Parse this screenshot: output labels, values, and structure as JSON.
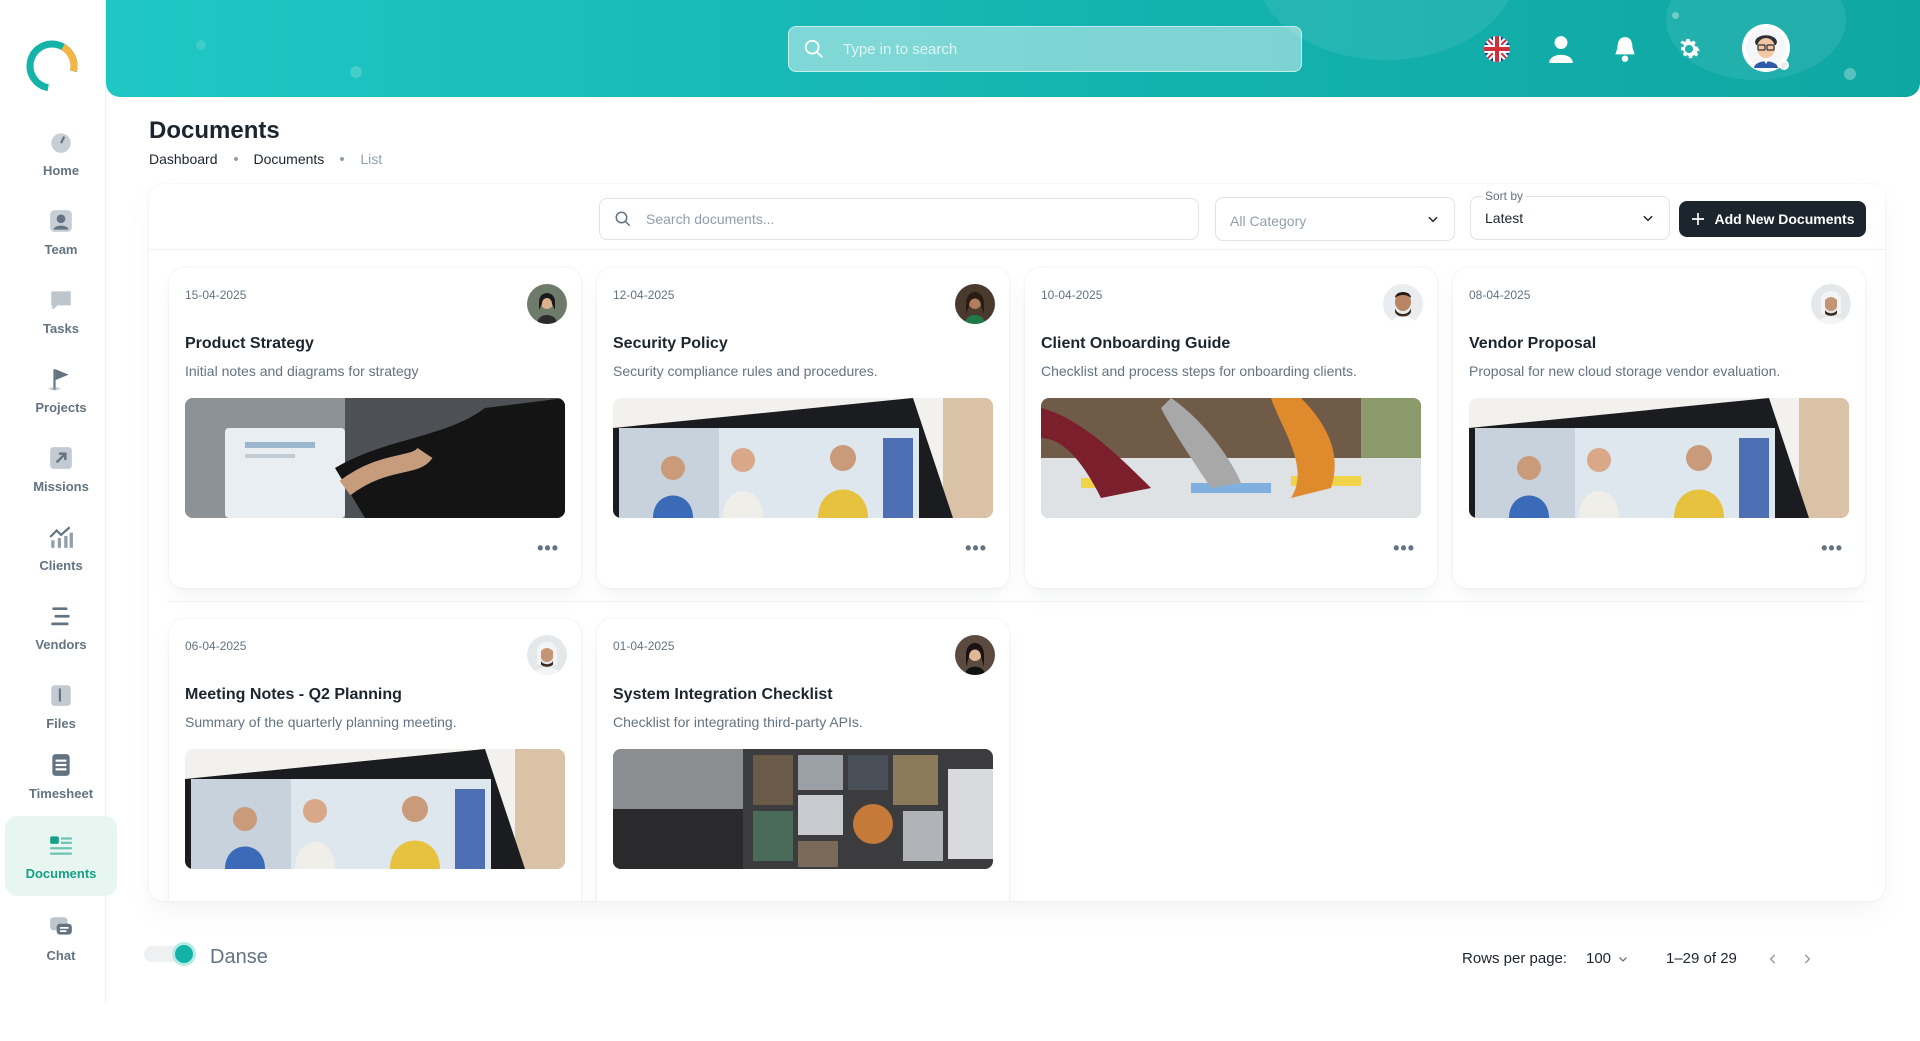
{
  "header": {
    "search_placeholder": "Type in to search"
  },
  "sidebar": {
    "items": [
      {
        "label": "Home",
        "icon": "dashboard-icon"
      },
      {
        "label": "Team",
        "icon": "user-icon"
      },
      {
        "label": "Tasks",
        "icon": "task-icon"
      },
      {
        "label": "Projects",
        "icon": "flag-icon"
      },
      {
        "label": "Missions",
        "icon": "arrow-icon"
      },
      {
        "label": "Clients",
        "icon": "chart-icon"
      },
      {
        "label": "Vendors",
        "icon": "list-icon"
      },
      {
        "label": "Files",
        "icon": "file-icon"
      },
      {
        "label": "Timesheet",
        "icon": "clipboard-icon"
      },
      {
        "label": "Documents",
        "icon": "documents-icon",
        "active": true
      },
      {
        "label": "Chat",
        "icon": "chat-icon"
      }
    ]
  },
  "page": {
    "title": "Documents",
    "breadcrumb": [
      "Dashboard",
      "Documents",
      "List"
    ]
  },
  "toolbar": {
    "search_placeholder": "Search documents...",
    "category_value": "All Category",
    "sort_label": "Sort by",
    "sort_value": "Latest",
    "add_label": "Add New Documents"
  },
  "documents": [
    {
      "date": "15-04-2025",
      "title": "Product Strategy",
      "description": "Initial notes and diagrams for strategy"
    },
    {
      "date": "12-04-2025",
      "title": "Security Policy",
      "description": "Security compliance rules and procedures."
    },
    {
      "date": "10-04-2025",
      "title": "Client Onboarding Guide",
      "description": "Checklist and process steps for onboarding clients."
    },
    {
      "date": "08-04-2025",
      "title": "Vendor Proposal",
      "description": "Proposal for new cloud storage vendor evaluation."
    },
    {
      "date": "06-04-2025",
      "title": "Meeting Notes - Q2 Planning",
      "description": "Summary of the quarterly planning meeting."
    },
    {
      "date": "01-04-2025",
      "title": "System Integration Checklist",
      "description": "Checklist for integrating third-party APIs."
    }
  ],
  "footer": {
    "toggle_label": "Danse",
    "rows_label": "Rows per page:",
    "rows_value": "100",
    "range": "1–29 of 29"
  },
  "colors": {
    "accent": "#14b3b0",
    "active_nav": "#16a085",
    "dark_button": "#1c252e"
  }
}
